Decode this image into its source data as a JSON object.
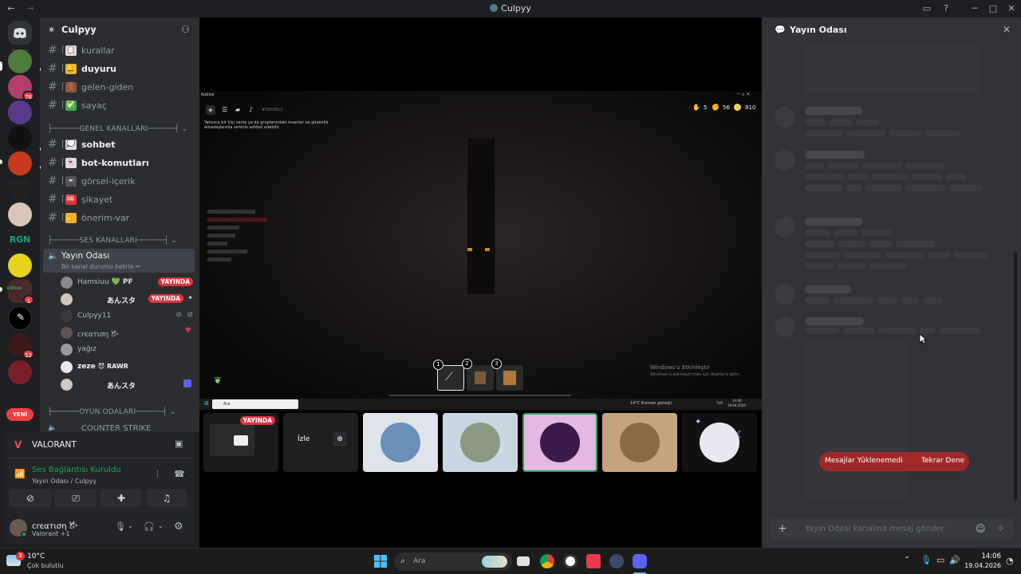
{
  "window": {
    "title": "Culpyy"
  },
  "rail": {
    "badges": [
      "78",
      "1",
      "12"
    ],
    "new_label": "YENİ",
    "sidenex_label": "sidnex",
    "colors": [
      "#4e7a3b",
      "#b0406a",
      "#5b3a8a",
      "#111111",
      "#c63b1e",
      "#222222",
      "#d9c6b8",
      "#1aa37a",
      "#e8d21c",
      "#4a2a2a",
      "#000000",
      "#3d1a1a",
      "#7a1f2a"
    ]
  },
  "sidebar": {
    "server_name": "Culpyy",
    "channels_top": [
      {
        "emoji": "📋",
        "name": "kurallar",
        "unread": false
      },
      {
        "emoji": "🔔",
        "name": "duyuru",
        "unread": true
      },
      {
        "emoji": "🚪",
        "name": "gelen-giden",
        "unread": false
      },
      {
        "emoji": "✅",
        "name": "sayaç",
        "unread": false
      }
    ],
    "category_general": "├──────GENEL KANALLARI──────┤",
    "channels_general": [
      {
        "emoji": "💭",
        "name": "sohbet",
        "unread": true
      },
      {
        "emoji": "👻",
        "name": "bot-komutları",
        "unread": true
      },
      {
        "emoji": "📼",
        "name": "görsel-içerik",
        "unread": false
      },
      {
        "emoji": "🆘",
        "name": "şikayet",
        "unread": false
      },
      {
        "emoji": "👍",
        "name": "önerim-var",
        "unread": false
      }
    ],
    "category_voice": "├──────SES KANALLARI──────┤",
    "voice_channel": {
      "name": "Yayın Odası",
      "status": "Bir kanal durumu belirle ✏"
    },
    "voice_users": [
      {
        "name": "Hamsiuu",
        "extra": "💚 PF",
        "live": "YAYINDA"
      },
      {
        "name": "あんスタ",
        "extra": "",
        "live": "YAYINDA"
      },
      {
        "name": "Culpyy11",
        "extra": "",
        "live": ""
      },
      {
        "name": "crєαтιση 𐂂",
        "extra": "",
        "live": ""
      },
      {
        "name": "yağız",
        "extra": "",
        "live": ""
      },
      {
        "name": "zeze",
        "extra": "😈 RAWR",
        "live": ""
      },
      {
        "name": "あんスタ",
        "extra": "",
        "live": ""
      }
    ],
    "category_games": "├──────OYUN ODALARI──────┤",
    "game_channel": "COUNTER STRIKE"
  },
  "activity": {
    "game": "VALORANT",
    "connection": "Ses Bağlantısı Kuruldu",
    "connection_sub": "Yayın Odası / Culpyy"
  },
  "user": {
    "name": "crєαтιση 𐂂",
    "status": "Valorant +1"
  },
  "stage": {
    "window_label": "Roblox",
    "game_id": "#3900812",
    "chat_notice": "Yalnızca bir kişi varsa ya da gruplarındaki insanlar ve güvenilir arkadaşlarınla seninle sohbet edebilir.",
    "stats": [
      "5",
      "56",
      "810"
    ],
    "hotbar": [
      "1",
      "2",
      "3"
    ],
    "windows_activation": "Windows'u Etkinleştir",
    "windows_activation_sub": "Windows'u etkinleştirmek için Ayarlar'a gidin.",
    "inner_search": "Ara",
    "inner_weather": "14°C  Kısmen güneşli",
    "inner_clock": "14:06",
    "inner_date": "19.04.2026",
    "inner_lang": "TUR"
  },
  "tiles": {
    "live_badge": "YAYINDA",
    "watch_label": "İzle"
  },
  "chat": {
    "title": "Yayın Odası",
    "error": "Mesajlar Yüklenemedi",
    "retry": "Tekrar Dene",
    "placeholder": "Yayın Odası kanalına mesaj gönder"
  },
  "taskbar": {
    "temp": "10°C",
    "weather": "Çok bulutlu",
    "search": "Ara",
    "time": "14:06",
    "date": "19.04.2026",
    "weather_badge": "3"
  }
}
